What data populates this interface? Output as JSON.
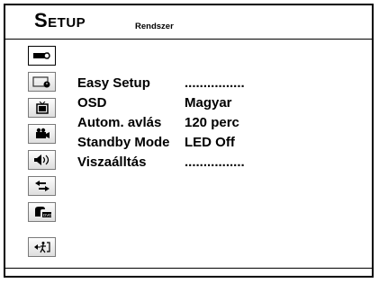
{
  "header": {
    "title": "Setup",
    "subtitle": "Rendszer"
  },
  "sidebar": {
    "items": [
      {
        "icon": "system-settings-icon",
        "active": true
      },
      {
        "icon": "clock-timer-icon",
        "active": false
      },
      {
        "icon": "tv-icon",
        "active": false
      },
      {
        "icon": "camera-video-icon",
        "active": false
      },
      {
        "icon": "audio-speaker-icon",
        "active": false
      },
      {
        "icon": "connection-arrows-icon",
        "active": false
      },
      {
        "icon": "dvd-disc-icon",
        "active": false
      },
      {
        "icon": "exit-icon",
        "active": false
      }
    ]
  },
  "menu": {
    "rows": [
      {
        "label": "Easy Setup",
        "value": "................"
      },
      {
        "label": "OSD",
        "value": "Magyar"
      },
      {
        "label": "Autom. avlás",
        "value": "120 perc"
      },
      {
        "label": "Standby Mode",
        "value": "LED Off"
      },
      {
        "label": "Viszaálltás",
        "value": "................"
      }
    ]
  }
}
